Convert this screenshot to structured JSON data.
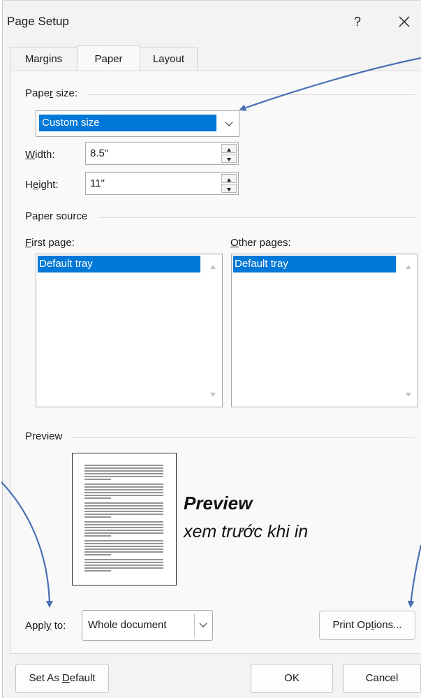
{
  "window": {
    "title": "Page Setup",
    "help_label": "?"
  },
  "tabs": [
    {
      "label": "Margins",
      "active": false
    },
    {
      "label": "Paper",
      "active": true
    },
    {
      "label": "Layout",
      "active": false
    }
  ],
  "paper_size": {
    "group_label_pre": "Pape",
    "group_label_u": "r",
    "group_label_post": " size:",
    "selected": "Custom size",
    "width_label_u": "W",
    "width_label_post": "idth:",
    "width_value": "8.5\"",
    "height_label_pre": "H",
    "height_label_u": "e",
    "height_label_post": "ight:",
    "height_value": "11\""
  },
  "paper_source": {
    "group_label": "Paper source",
    "first_page_label_u": "F",
    "first_page_label_post": "irst page:",
    "first_page_items": [
      "Default tray"
    ],
    "other_pages_label_u": "O",
    "other_pages_label_post": "ther pages:",
    "other_pages_items": [
      "Default tray"
    ]
  },
  "preview": {
    "group_label": "Preview",
    "annotation_title": "Preview",
    "annotation_subtitle": "xem trước khi in"
  },
  "apply_to": {
    "label_pre": "Appl",
    "label_u": "y",
    "label_post": " to:",
    "selected": "Whole document"
  },
  "buttons": {
    "print_options_pre": "Print Op",
    "print_options_u": "t",
    "print_options_post": "ions...",
    "set_as_default_pre": "Set As ",
    "set_as_default_u": "D",
    "set_as_default_post": "efault",
    "ok": "OK",
    "cancel": "Cancel"
  },
  "colors": {
    "selection": "#0078d7",
    "annotation_arrow": "#4a6fb5",
    "dialog_bg": "#f3f3f3"
  }
}
